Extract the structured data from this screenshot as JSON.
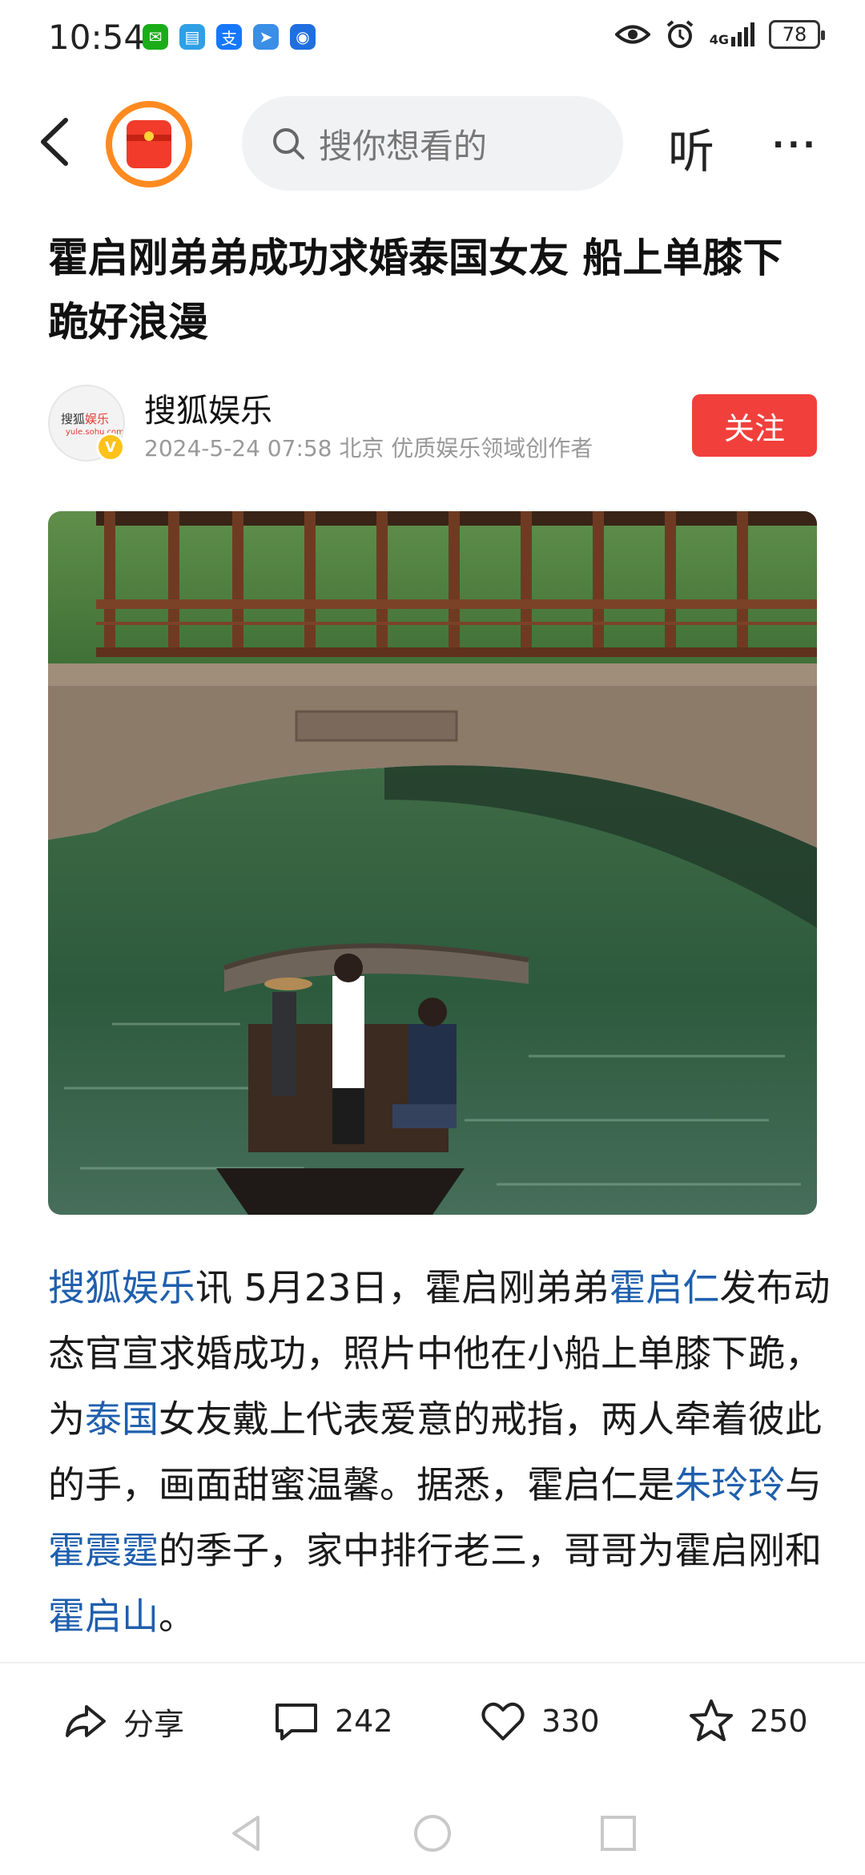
{
  "status_bar": {
    "time": "10:54",
    "network": "4G",
    "battery": "78",
    "apps": [
      {
        "name": "wechat",
        "color": "#1aad19",
        "glyph": "✉"
      },
      {
        "name": "store",
        "color": "#2fa0e6",
        "glyph": "▤"
      },
      {
        "name": "alipay",
        "color": "#1677ff",
        "glyph": "支"
      },
      {
        "name": "maps",
        "color": "#3a8ee6",
        "glyph": "➤"
      },
      {
        "name": "tips",
        "color": "#1f6fe0",
        "glyph": "◉"
      }
    ]
  },
  "nav": {
    "search_placeholder": "搜你想看的",
    "listen_label": "听",
    "more_label": "···"
  },
  "article": {
    "title": "霍启刚弟弟成功求婚泰国女友 船上单膝下跪好浪漫",
    "author": {
      "name": "搜狐娱乐",
      "meta": "2024-5-24  07:58  北京  优质娱乐领域创作者",
      "avatar_text_1": "搜狐",
      "avatar_text_2": "娱乐",
      "avatar_sub": "yule.sohu.com",
      "verify": "V",
      "follow_label": "关注"
    },
    "body": {
      "link_source": "搜狐娱乐",
      "t1": "讯 5月23日，霍启刚弟弟",
      "link_person1": "霍启仁",
      "t2": "发布动态官宣求婚成功，照片中他在小船上单膝下跪，为",
      "link_place": "泰国",
      "t3": "女友戴上代表爱意的戒指，两人牵着彼此的手，画面甜蜜温馨。据悉，霍启仁是",
      "link_person2": "朱玲玲",
      "t4": "与",
      "link_person3": "霍震霆",
      "t5": "的季子，家中排行老三，哥哥为霍启刚和 ",
      "link_person4": "霍启山",
      "t6": "。"
    }
  },
  "actions": {
    "share_label": "分享",
    "comments_count": "242",
    "likes_count": "330",
    "favorites_count": "250"
  }
}
